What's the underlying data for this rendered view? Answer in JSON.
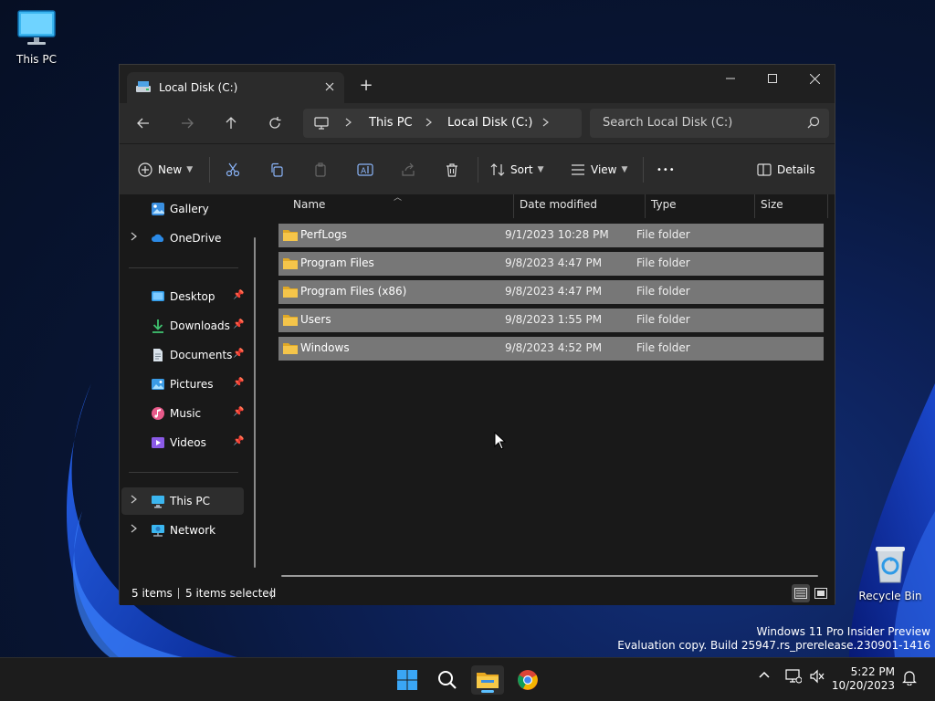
{
  "desktop": {
    "icons": [
      {
        "label": "This PC"
      },
      {
        "label": "Recycle Bin"
      }
    ],
    "watermark": {
      "line1": "Windows 11 Pro Insider Preview",
      "line2": "Evaluation copy. Build 25947.rs_prerelease.230901-1416"
    }
  },
  "window": {
    "tab_title": "Local Disk (C:)",
    "new_tab": "+",
    "address": {
      "crumbs": [
        "This PC",
        "Local Disk (C:)"
      ]
    },
    "search": {
      "placeholder": "Search Local Disk (C:)"
    },
    "toolbar": {
      "new_label": "New",
      "sort_label": "Sort",
      "view_label": "View",
      "more_label": "•••",
      "details_label": "Details"
    },
    "sidebar": {
      "items": [
        {
          "label": "Gallery",
          "icon": "gallery-icon"
        },
        {
          "label": "OneDrive",
          "icon": "onedrive-icon"
        },
        {
          "label": "Desktop",
          "icon": "desktop-folder-icon"
        },
        {
          "label": "Downloads",
          "icon": "downloads-icon"
        },
        {
          "label": "Documents",
          "icon": "documents-icon"
        },
        {
          "label": "Pictures",
          "icon": "pictures-icon"
        },
        {
          "label": "Music",
          "icon": "music-icon"
        },
        {
          "label": "Videos",
          "icon": "videos-icon"
        },
        {
          "label": "This PC",
          "icon": "this-pc-icon"
        },
        {
          "label": "Network",
          "icon": "network-icon"
        }
      ]
    },
    "columns": [
      "Name",
      "Date modified",
      "Type",
      "Size"
    ],
    "rows": [
      {
        "name": "PerfLogs",
        "date": "9/1/2023 10:28 PM",
        "type": "File folder",
        "size": ""
      },
      {
        "name": "Program Files",
        "date": "9/8/2023 4:47 PM",
        "type": "File folder",
        "size": ""
      },
      {
        "name": "Program Files (x86)",
        "date": "9/8/2023 4:47 PM",
        "type": "File folder",
        "size": ""
      },
      {
        "name": "Users",
        "date": "9/8/2023 1:55 PM",
        "type": "File folder",
        "size": ""
      },
      {
        "name": "Windows",
        "date": "9/8/2023 4:52 PM",
        "type": "File folder",
        "size": ""
      }
    ],
    "status": {
      "count": "5 items",
      "selected": "5 items selected"
    }
  },
  "taskbar": {
    "clock": {
      "time": "5:22 PM",
      "date": "10/20/2023"
    }
  },
  "colors": {
    "accent": "#5cc0ff",
    "folder": "#f5c54a",
    "selection": "#777777"
  }
}
